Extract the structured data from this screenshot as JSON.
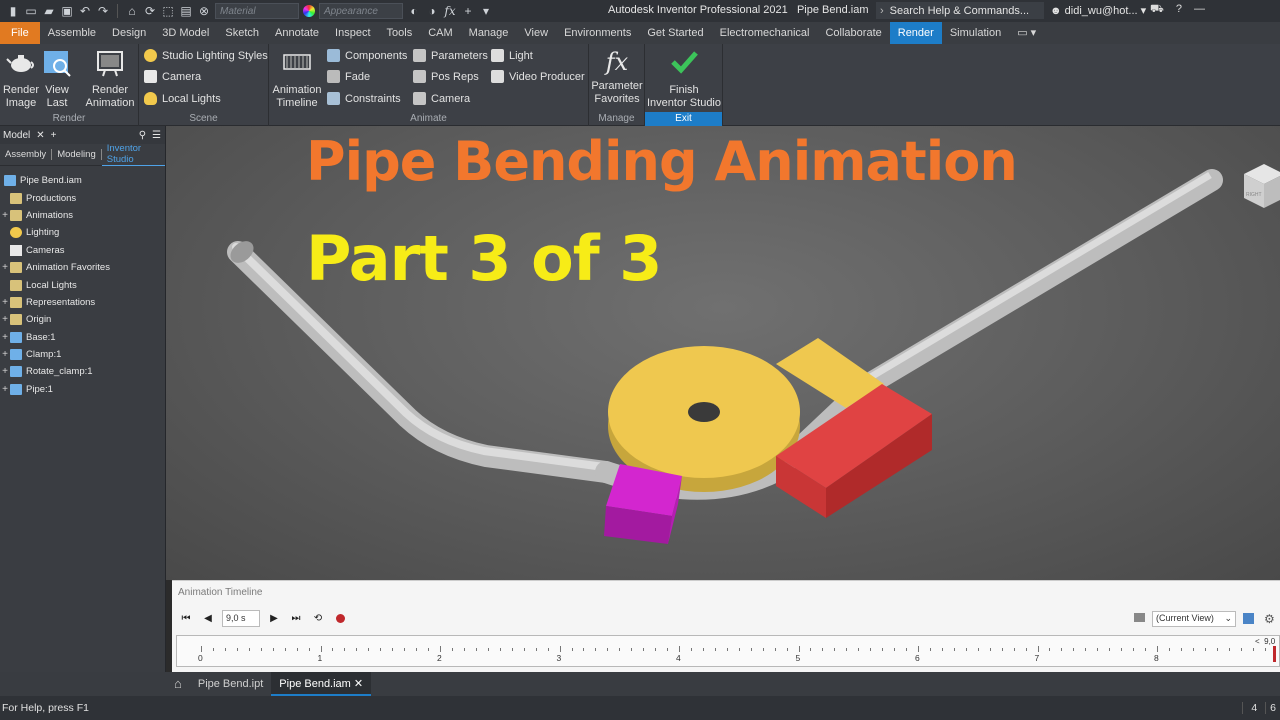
{
  "title_bar": {
    "material_placeholder": "Material",
    "appearance_placeholder": "Appearance",
    "app_title": "Autodesk Inventor Professional 2021",
    "document": "Pipe Bend.iam",
    "search": "Search Help & Commands...",
    "user": "didi_wu@hot..."
  },
  "menu_tabs": [
    "File",
    "Assemble",
    "Design",
    "3D Model",
    "Sketch",
    "Annotate",
    "Inspect",
    "Tools",
    "CAM",
    "Manage",
    "View",
    "Environments",
    "Get Started",
    "Electromechanical",
    "Collaborate",
    "Render",
    "Simulation"
  ],
  "active_tab": "Render",
  "ribbon": {
    "render": {
      "label": "Render",
      "render_image": [
        "Render",
        "Image"
      ],
      "view_last": [
        "View",
        "Last"
      ],
      "render_animation": [
        "Render",
        "Animation"
      ]
    },
    "scene": {
      "label": "Scene",
      "studio_lighting": "Studio Lighting Styles",
      "camera": "Camera",
      "local_lights": "Local Lights"
    },
    "animate": {
      "label": "Animate",
      "animation_timeline": [
        "Animation",
        "Timeline"
      ],
      "components": "Components",
      "fade": "Fade",
      "constraints": "Constraints",
      "parameters": "Parameters",
      "pos_reps": "Pos Reps",
      "camera": "Camera",
      "light": "Light",
      "video_producer": "Video Producer"
    },
    "manage": {
      "label": "Manage",
      "parameter_favorites": [
        "Parameter",
        "Favorites"
      ]
    },
    "exit": {
      "label": "Exit",
      "finish": [
        "Finish",
        "Inventor Studio"
      ]
    }
  },
  "browser": {
    "tab": "Model",
    "subtabs": [
      "Assembly",
      "Modeling",
      "Inventor Studio"
    ],
    "root": "Pipe Bend.iam",
    "items": [
      {
        "label": "Productions",
        "expandable": false
      },
      {
        "label": "Animations",
        "expandable": true
      },
      {
        "label": "Lighting",
        "expandable": false
      },
      {
        "label": "Cameras",
        "expandable": false
      },
      {
        "label": "Animation Favorites",
        "expandable": true
      },
      {
        "label": "Local Lights",
        "expandable": false
      },
      {
        "label": "Representations",
        "expandable": true
      },
      {
        "label": "Origin",
        "expandable": true
      },
      {
        "label": "Base:1",
        "expandable": true
      },
      {
        "label": "Clamp:1",
        "expandable": true
      },
      {
        "label": "Rotate_clamp:1",
        "expandable": true
      },
      {
        "label": "Pipe:1",
        "expandable": true
      }
    ]
  },
  "overlay": {
    "title": "Pipe Bending Animation",
    "subtitle": "Part 3 of 3"
  },
  "viewcube_label": "RIGHT",
  "timeline": {
    "title": "Animation Timeline",
    "time_value": "9,0 s",
    "view_select": "(Current View)",
    "end_marker": "9,0",
    "ticks": [
      "0",
      "1",
      "2",
      "3",
      "4",
      "5",
      "6",
      "7",
      "8"
    ]
  },
  "doc_tabs": [
    "Pipe Bend.ipt",
    "Pipe Bend.iam"
  ],
  "active_doc": "Pipe Bend.iam",
  "status": {
    "help": "For Help, press F1",
    "count_a": "4",
    "count_b": "6"
  },
  "colors": {
    "accent": "#1d7dc8",
    "file_tab": "#e17a21",
    "title_text": "#f2772d",
    "subtitle_text": "#f7ec17",
    "pipe": "#c8c8c8",
    "die": "#efc84f",
    "clamp": "#d93333",
    "pressure_block": "#c71fc0"
  }
}
